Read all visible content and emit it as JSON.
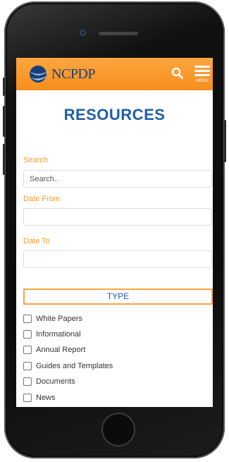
{
  "header": {
    "logo_text": "NCPDP",
    "menu_label": "MENU",
    "icons": [
      "search-icon",
      "hamburger-menu-icon"
    ]
  },
  "page_title": "RESOURCES",
  "form": {
    "search_label": "Search",
    "search_placeholder": "Search..",
    "date_from_label": "Date From",
    "date_to_label": "Date To"
  },
  "type_section": {
    "title": "TYPE",
    "options": [
      "White Papers",
      "Informational",
      "Annual Report",
      "Guides and Templates",
      "Documents",
      "News"
    ]
  },
  "colors": {
    "header": "#f7941d",
    "accent_orange": "#f39a2f",
    "title_blue": "#1f5ea6",
    "logo_blue": "#1a3f78"
  }
}
